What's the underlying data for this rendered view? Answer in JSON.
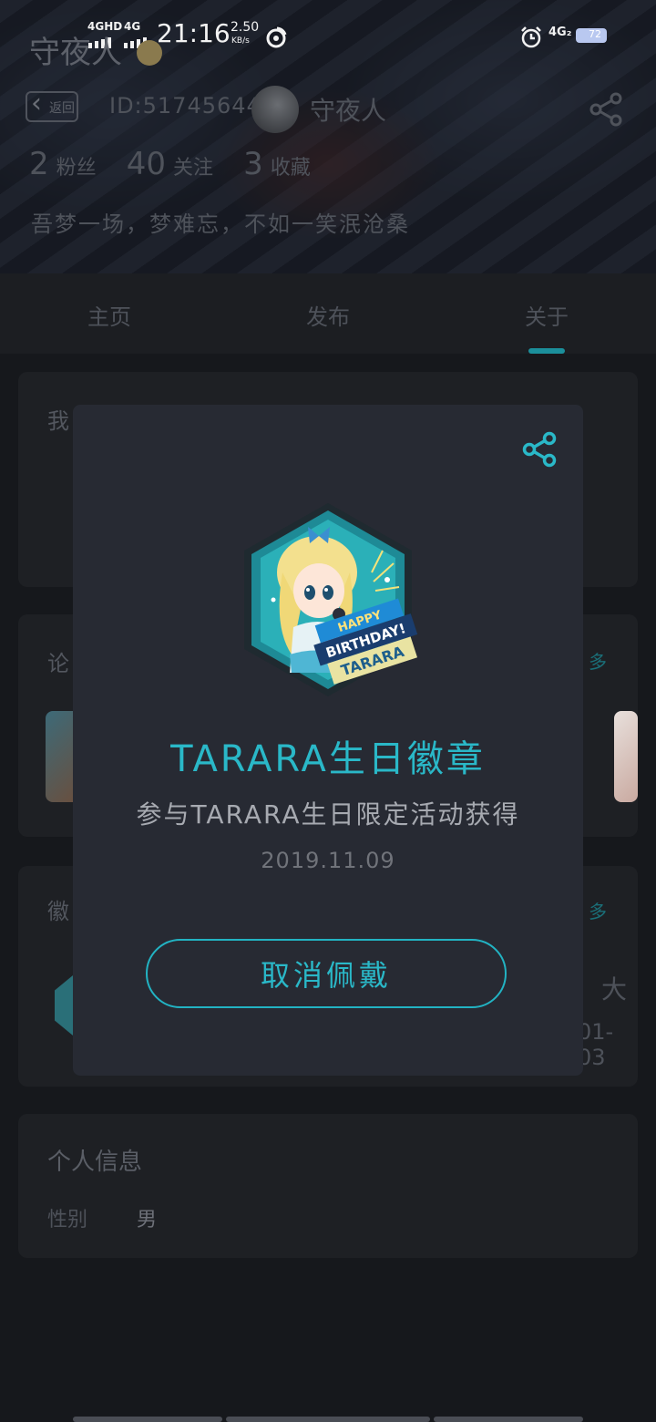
{
  "status_bar": {
    "network1": "4GHD",
    "network2": "4G",
    "time": "21:16",
    "speed_value": "2.50",
    "speed_unit": "KB/s",
    "right_network": "4G₂",
    "battery": "72"
  },
  "profile": {
    "username": "守夜人",
    "back_label": "返回",
    "id_text": "ID:51745644",
    "nickname": "守夜人",
    "stats": [
      {
        "value": "2",
        "label": "粉丝"
      },
      {
        "value": "40",
        "label": "关注"
      },
      {
        "value": "3",
        "label": "收藏"
      }
    ],
    "bio": "吾梦一场，梦难忘，不如一笑泯沧桑"
  },
  "tabs": [
    {
      "label": "主页",
      "active": false
    },
    {
      "label": "发布",
      "active": false
    },
    {
      "label": "关于",
      "active": true
    }
  ],
  "cards": {
    "card1_title": "我",
    "card2_title": "论",
    "card2_more": "多",
    "card3_title": "徽",
    "card3_more": "多",
    "card3_side_text": "大",
    "card3_side_date": "01-03",
    "personal_info_title": "个人信息",
    "gender_label": "性别",
    "gender_value": "男"
  },
  "modal": {
    "badge_name": "TARARA生日徽章",
    "badge_description": "参与TARARA生日限定活动获得",
    "badge_date": "2019.11.09",
    "badge_art_text_1": "HAPPY",
    "badge_art_text_2": "BIRTHDAY!",
    "badge_art_text_3": "TARARA",
    "unwear_button": "取消佩戴"
  },
  "colors": {
    "accent": "#2ab8c8",
    "modal_bg": "#272a33",
    "page_bg": "#16181c"
  }
}
